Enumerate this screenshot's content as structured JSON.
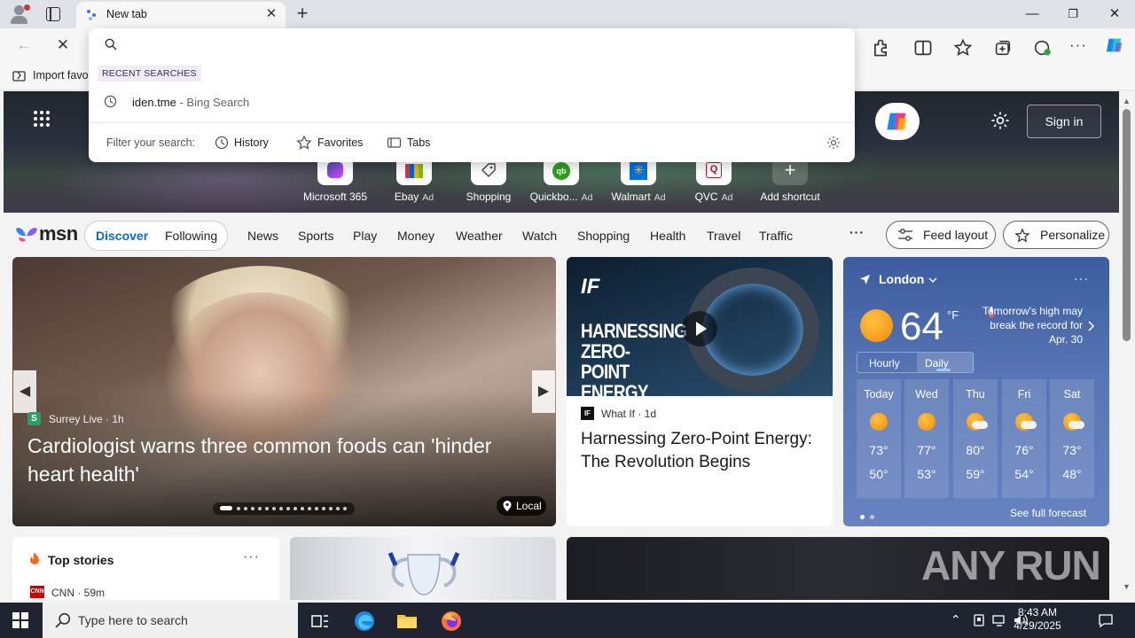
{
  "browser": {
    "tab_title": "New tab",
    "import_favorites": "Import favo"
  },
  "omnibox": {
    "recent_header": "RECENT SEARCHES",
    "recent_query": "iden.tme",
    "recent_suffix": " - Bing Search",
    "filter_label": "Filter your search:",
    "filters": [
      "History",
      "Favorites",
      "Tabs"
    ]
  },
  "hero": {
    "sign_in": "Sign in",
    "shortcuts": [
      {
        "label": "Microsoft 365",
        "ad": ""
      },
      {
        "label": "Ebay",
        "ad": "Ad"
      },
      {
        "label": "Shopping",
        "ad": ""
      },
      {
        "label": "Quickbo...",
        "ad": "Ad"
      },
      {
        "label": "Walmart",
        "ad": "Ad"
      },
      {
        "label": "QVC",
        "ad": "Ad"
      },
      {
        "label": "Add shortcut",
        "ad": ""
      }
    ]
  },
  "msn": {
    "logo": "msn",
    "discover": "Discover",
    "following": "Following",
    "nav": [
      "News",
      "Sports",
      "Play",
      "Money",
      "Weather",
      "Watch",
      "Shopping",
      "Health",
      "Travel",
      "Traffic"
    ],
    "more": "···",
    "feed_layout": "Feed layout",
    "personalize": "Personalize"
  },
  "feature_card": {
    "source_badge": "S",
    "source": "Surrey Live · 1h",
    "headline": "Cardiologist warns three common foods can 'hinder heart health'",
    "local": "Local"
  },
  "video_card": {
    "logo": "IF",
    "thumb_title": "HARNESSING ZERO-POINT ENERGY",
    "source_icon": "IF",
    "source": "What If · 1d",
    "headline": "Harnessing Zero-Point Energy: The Revolution Begins"
  },
  "weather": {
    "location": "London",
    "temp": "64",
    "unit": "°F",
    "note": "Tomorrow's high may break the record for Apr. 30",
    "modes": [
      "Hourly",
      "Daily"
    ],
    "days": [
      {
        "name": "Today",
        "hi": "73°",
        "lo": "50°",
        "icon": "sun"
      },
      {
        "name": "Wed",
        "hi": "77°",
        "lo": "53°",
        "icon": "sun"
      },
      {
        "name": "Thu",
        "hi": "80°",
        "lo": "59°",
        "icon": "partly-cloudy"
      },
      {
        "name": "Fri",
        "hi": "76°",
        "lo": "54°",
        "icon": "partly-cloudy"
      },
      {
        "name": "Sat",
        "hi": "73°",
        "lo": "48°",
        "icon": "partly-cloudy"
      }
    ],
    "see_full": "See full forecast"
  },
  "top_stories": {
    "title": "Top stories",
    "more": "···",
    "source_icon": "CNN",
    "source": "CNN · 59m"
  },
  "watermark": "ANY RUN",
  "taskbar": {
    "search_placeholder": "Type here to search",
    "time": "8:43 AM",
    "date": "4/29/2025"
  }
}
